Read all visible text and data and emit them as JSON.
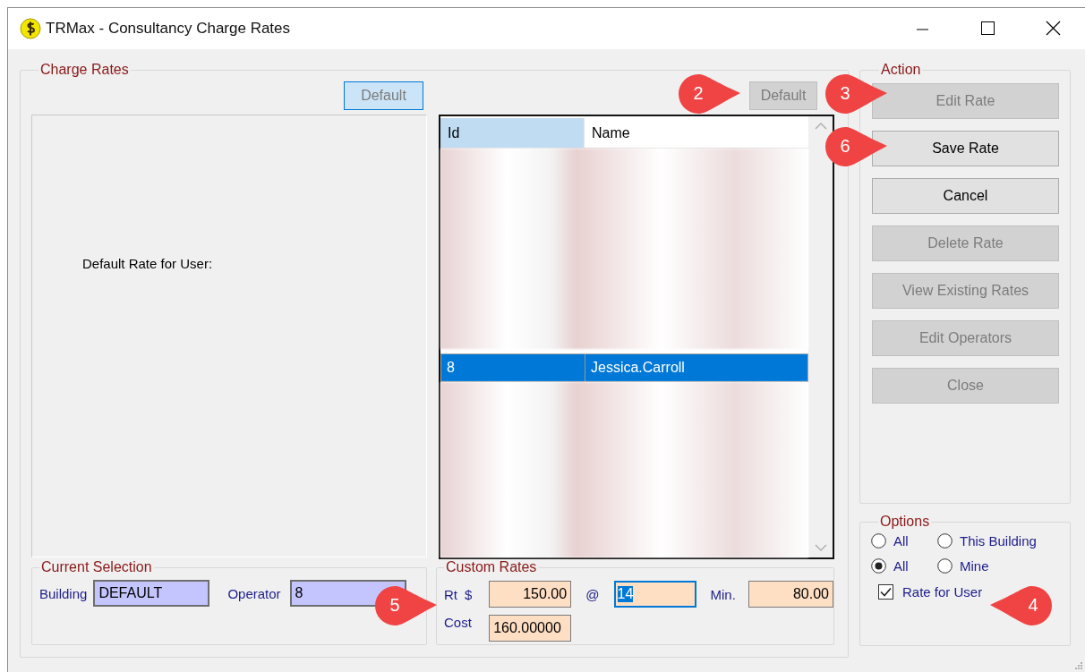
{
  "window": {
    "title": "TRMax - Consultancy Charge Rates"
  },
  "charge_rates": {
    "title": "Charge Rates",
    "default_buttons": [
      {
        "label": "Default",
        "disabled": true,
        "hovered": true
      },
      {
        "label": "Default",
        "disabled": true,
        "hovered": false
      }
    ],
    "default_rate_label": "Default Rate for User:",
    "list": {
      "columns": [
        {
          "label": "Id",
          "selected": true
        },
        {
          "label": "Name",
          "selected": false
        }
      ],
      "rows": [
        {
          "cells": [
            "8",
            "Jessica.Carroll"
          ],
          "selected": true
        }
      ]
    }
  },
  "current_selection": {
    "title": "Current Selection",
    "fields": [
      {
        "label": "Building",
        "value": "DEFAULT"
      },
      {
        "label": "Operator",
        "value": "8"
      }
    ]
  },
  "custom_rates": {
    "title": "Custom Rates",
    "rate_label": "Rt",
    "currency": "$",
    "rate": "150.00",
    "at": "@",
    "minutes": "14",
    "minutes_focused": true,
    "min_label": "Min.",
    "min_value": "80.00",
    "cost_label": "Cost",
    "cost": "160.00000"
  },
  "action": {
    "title": "Action",
    "buttons": [
      {
        "label": "Edit Rate",
        "disabled": true
      },
      {
        "label": "Save Rate",
        "disabled": false
      },
      {
        "label": "Cancel",
        "disabled": false
      },
      {
        "label": "Delete Rate",
        "disabled": true
      },
      {
        "label": "View Existing Rates",
        "disabled": true
      },
      {
        "label": "Edit Operators",
        "disabled": true
      },
      {
        "label": "Close",
        "disabled": true
      }
    ]
  },
  "options": {
    "title": "Options",
    "radios": [
      {
        "label": "All",
        "selected": false
      },
      {
        "label": "This Building",
        "selected": false
      },
      {
        "label": "All",
        "selected": true
      },
      {
        "label": "Mine",
        "selected": false
      }
    ],
    "checkbox": {
      "label": "Rate for User",
      "checked": true
    }
  },
  "callouts": [
    {
      "label": "2",
      "kind": "right"
    },
    {
      "label": "3",
      "kind": "right"
    },
    {
      "label": "6",
      "kind": "right"
    },
    {
      "label": "5",
      "kind": "right"
    },
    {
      "label": "4",
      "kind": "left"
    }
  ]
}
